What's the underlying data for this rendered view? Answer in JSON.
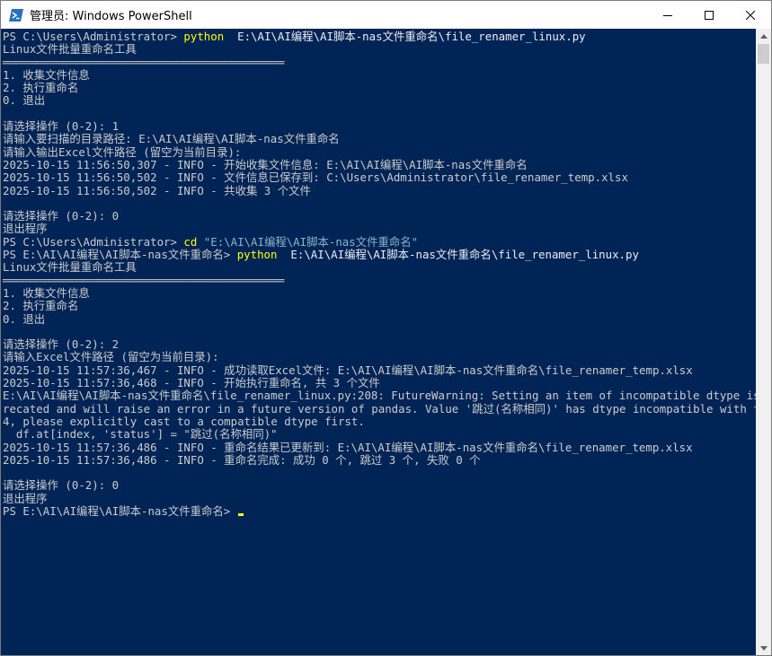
{
  "window": {
    "title": "管理员: Windows PowerShell",
    "background": "#012456",
    "foreground": "#cccccc"
  },
  "console": {
    "lines": [
      {
        "segments": [
          {
            "t": "PS C:\\Users\\Administrator> "
          },
          {
            "t": "python",
            "c": "cmd"
          },
          {
            "t": "  E:\\AI\\AI编程\\AI脚本-nas文件重命名\\file_renamer_linux.py",
            "c": "arg"
          }
        ]
      },
      {
        "segments": [
          {
            "t": "Linux文件批量重命名工具"
          }
        ]
      },
      {
        "segments": [
          {
            "t": "══════════════════════════════════════════"
          }
        ]
      },
      {
        "segments": [
          {
            "t": "1. 收集文件信息"
          }
        ]
      },
      {
        "segments": [
          {
            "t": "2. 执行重命名"
          }
        ]
      },
      {
        "segments": [
          {
            "t": "0. 退出"
          }
        ]
      },
      {
        "segments": [
          {
            "t": ""
          }
        ]
      },
      {
        "segments": [
          {
            "t": "请选择操作 (0-2): 1"
          }
        ]
      },
      {
        "segments": [
          {
            "t": "请输入要扫描的目录路径: E:\\AI\\AI编程\\AI脚本-nas文件重命名"
          }
        ]
      },
      {
        "segments": [
          {
            "t": "请输入输出Excel文件路径 (留空为当前目录):"
          }
        ]
      },
      {
        "segments": [
          {
            "t": "2025-10-15 11:56:50,307 - INFO - 开始收集文件信息: E:\\AI\\AI编程\\AI脚本-nas文件重命名"
          }
        ]
      },
      {
        "segments": [
          {
            "t": "2025-10-15 11:56:50,502 - INFO - 文件信息已保存到: C:\\Users\\Administrator\\file_renamer_temp.xlsx"
          }
        ]
      },
      {
        "segments": [
          {
            "t": "2025-10-15 11:56:50,502 - INFO - 共收集 3 个文件"
          }
        ]
      },
      {
        "segments": [
          {
            "t": ""
          }
        ]
      },
      {
        "segments": [
          {
            "t": "请选择操作 (0-2): 0"
          }
        ]
      },
      {
        "segments": [
          {
            "t": "退出程序"
          }
        ]
      },
      {
        "segments": [
          {
            "t": "PS C:\\Users\\Administrator> "
          },
          {
            "t": "cd",
            "c": "cmd"
          },
          {
            "t": " \"E:\\AI\\AI编程\\AI脚本-nas文件重命名\"",
            "c": "str"
          }
        ]
      },
      {
        "segments": [
          {
            "t": "PS E:\\AI\\AI编程\\AI脚本-nas文件重命名> "
          },
          {
            "t": "python",
            "c": "cmd"
          },
          {
            "t": "  E:\\AI\\AI编程\\AI脚本-nas文件重命名\\file_renamer_linux.py",
            "c": "arg"
          }
        ]
      },
      {
        "segments": [
          {
            "t": "Linux文件批量重命名工具"
          }
        ]
      },
      {
        "segments": [
          {
            "t": "══════════════════════════════════════════"
          }
        ]
      },
      {
        "segments": [
          {
            "t": "1. 收集文件信息"
          }
        ]
      },
      {
        "segments": [
          {
            "t": "2. 执行重命名"
          }
        ]
      },
      {
        "segments": [
          {
            "t": "0. 退出"
          }
        ]
      },
      {
        "segments": [
          {
            "t": ""
          }
        ]
      },
      {
        "segments": [
          {
            "t": "请选择操作 (0-2): 2"
          }
        ]
      },
      {
        "segments": [
          {
            "t": "请输入Excel文件路径 (留空为当前目录):"
          }
        ]
      },
      {
        "segments": [
          {
            "t": "2025-10-15 11:57:36,467 - INFO - 成功读取Excel文件: E:\\AI\\AI编程\\AI脚本-nas文件重命名\\file_renamer_temp.xlsx"
          }
        ]
      },
      {
        "segments": [
          {
            "t": "2025-10-15 11:57:36,468 - INFO - 开始执行重命名, 共 3 个文件"
          }
        ]
      },
      {
        "segments": [
          {
            "t": "E:\\AI\\AI编程\\AI脚本-nas文件重命名\\file_renamer_linux.py:208: FutureWarning: Setting an item of incompatible dtype is dep"
          }
        ]
      },
      {
        "segments": [
          {
            "t": "recated and will raise an error in a future version of pandas. Value '跳过(名称相同)' has dtype incompatible with float6"
          }
        ]
      },
      {
        "segments": [
          {
            "t": "4, please explicitly cast to a compatible dtype first."
          }
        ]
      },
      {
        "segments": [
          {
            "t": "  df.at[index, 'status'] = \"跳过(名称相同)\""
          }
        ]
      },
      {
        "segments": [
          {
            "t": "2025-10-15 11:57:36,486 - INFO - 重命名结果已更新到: E:\\AI\\AI编程\\AI脚本-nas文件重命名\\file_renamer_temp.xlsx"
          }
        ]
      },
      {
        "segments": [
          {
            "t": "2025-10-15 11:57:36,486 - INFO - 重命名完成: 成功 0 个, 跳过 3 个, 失败 0 个"
          }
        ]
      },
      {
        "segments": [
          {
            "t": ""
          }
        ]
      },
      {
        "segments": [
          {
            "t": "请选择操作 (0-2): 0"
          }
        ]
      },
      {
        "segments": [
          {
            "t": "退出程序"
          }
        ]
      },
      {
        "segments": [
          {
            "t": "PS E:\\AI\\AI编程\\AI脚本-nas文件重命名> "
          }
        ],
        "cursor": true
      }
    ]
  },
  "icons": {
    "app": "powershell-icon",
    "minimize": "minimize-icon",
    "maximize": "maximize-icon",
    "close": "close-icon",
    "scroll_up": "chevron-up-icon",
    "scroll_down": "chevron-down-icon"
  }
}
